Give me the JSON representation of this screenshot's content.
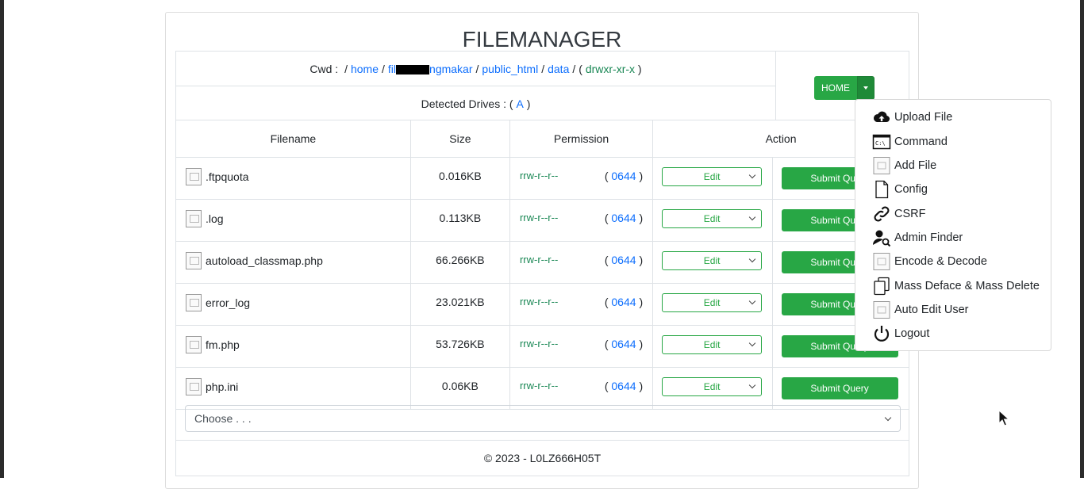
{
  "app": {
    "title": "FILEMANAGER"
  },
  "cwd": {
    "label": "Cwd :",
    "home": "home",
    "user_start": "fil",
    "user_end": "ngmakar",
    "public_html": "public_html",
    "data": "data",
    "sep": "/",
    "perm_open": "(",
    "perm": "drwxr-xr-x",
    "perm_close": ")"
  },
  "drives": {
    "label": "Detected Drives :",
    "open": "(",
    "drive": "A",
    "close": ")"
  },
  "home_button": {
    "label": "HOME"
  },
  "table": {
    "headers": [
      "Filename",
      "Size",
      "Permission",
      "Action"
    ],
    "rows": [
      {
        "name": ".ftpquota",
        "size": "0.016KB",
        "perm": "rrw-r--r--",
        "octal": "0644",
        "action": "Edit",
        "submit": "Submit Query"
      },
      {
        "name": ".log",
        "size": "0.113KB",
        "perm": "rrw-r--r--",
        "octal": "0644",
        "action": "Edit",
        "submit": "Submit Query"
      },
      {
        "name": "autoload_classmap.php",
        "size": "66.266KB",
        "perm": "rrw-r--r--",
        "octal": "0644",
        "action": "Edit",
        "submit": "Submit Query"
      },
      {
        "name": "error_log",
        "size": "23.021KB",
        "perm": "rrw-r--r--",
        "octal": "0644",
        "action": "Edit",
        "submit": "Submit Query"
      },
      {
        "name": "fm.php",
        "size": "53.726KB",
        "perm": "rrw-r--r--",
        "octal": "0644",
        "action": "Edit",
        "submit": "Submit Query"
      },
      {
        "name": "php.ini",
        "size": "0.06KB",
        "perm": "rrw-r--r--",
        "octal": "0644",
        "action": "Edit",
        "submit": "Submit Query"
      }
    ],
    "paren_open": "(",
    "paren_close": ")"
  },
  "choose": {
    "placeholder": "Choose . . ."
  },
  "footer": {
    "text": "© 2023 - L0LZ666H05T"
  },
  "menu": {
    "items": [
      {
        "label": "Upload File",
        "icon": "cloud-upload-icon"
      },
      {
        "label": "Command",
        "icon": "terminal-icon"
      },
      {
        "label": "Add File",
        "icon": "file-image-icon"
      },
      {
        "label": "Config",
        "icon": "file-icon"
      },
      {
        "label": "CSRF",
        "icon": "link-icon"
      },
      {
        "label": "Admin Finder",
        "icon": "user-search-icon"
      },
      {
        "label": "Encode & Decode",
        "icon": "file-image-icon"
      },
      {
        "label": "Mass Deface & Mass Delete",
        "icon": "copy-icon"
      },
      {
        "label": "Auto Edit User",
        "icon": "file-image-icon"
      },
      {
        "label": "Logout",
        "icon": "power-icon"
      }
    ]
  },
  "colors": {
    "accent": "#28a745",
    "link": "#0d6efd",
    "perm": "#198754"
  }
}
